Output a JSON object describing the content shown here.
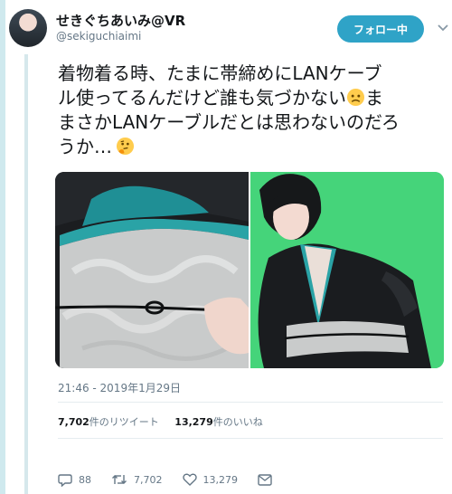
{
  "user": {
    "display_name": "せきぐちあいみ@VR",
    "handle": "@sekiguchiaimi"
  },
  "follow_button": {
    "label": "フォロー中"
  },
  "tweet": {
    "lines": [
      "着物着る時、たまに帯締めにLANケーブ",
      "ル使ってるんだけど誰も気づかない",
      "まさかLANケーブルだとは思わないのだろ",
      "うか…"
    ],
    "emojis": [
      "worried-face-emoji",
      "thinking-face-emoji"
    ]
  },
  "media": {
    "left_photo": "kimono-obi-lan-cable-closeup",
    "right_photo": "kimono-selfie-green-background"
  },
  "timestamp": "21:46 - 2019年1月29日",
  "stats": {
    "retweets_count": "7,702",
    "retweets_label": "件のリツイート",
    "likes_count": "13,279",
    "likes_label": "件のいいね"
  },
  "actions": {
    "reply_count": "88",
    "retweet_count": "7,702",
    "like_count": "13,279"
  },
  "colors": {
    "accent": "#2fa3c7",
    "secondary_text": "#657786"
  }
}
